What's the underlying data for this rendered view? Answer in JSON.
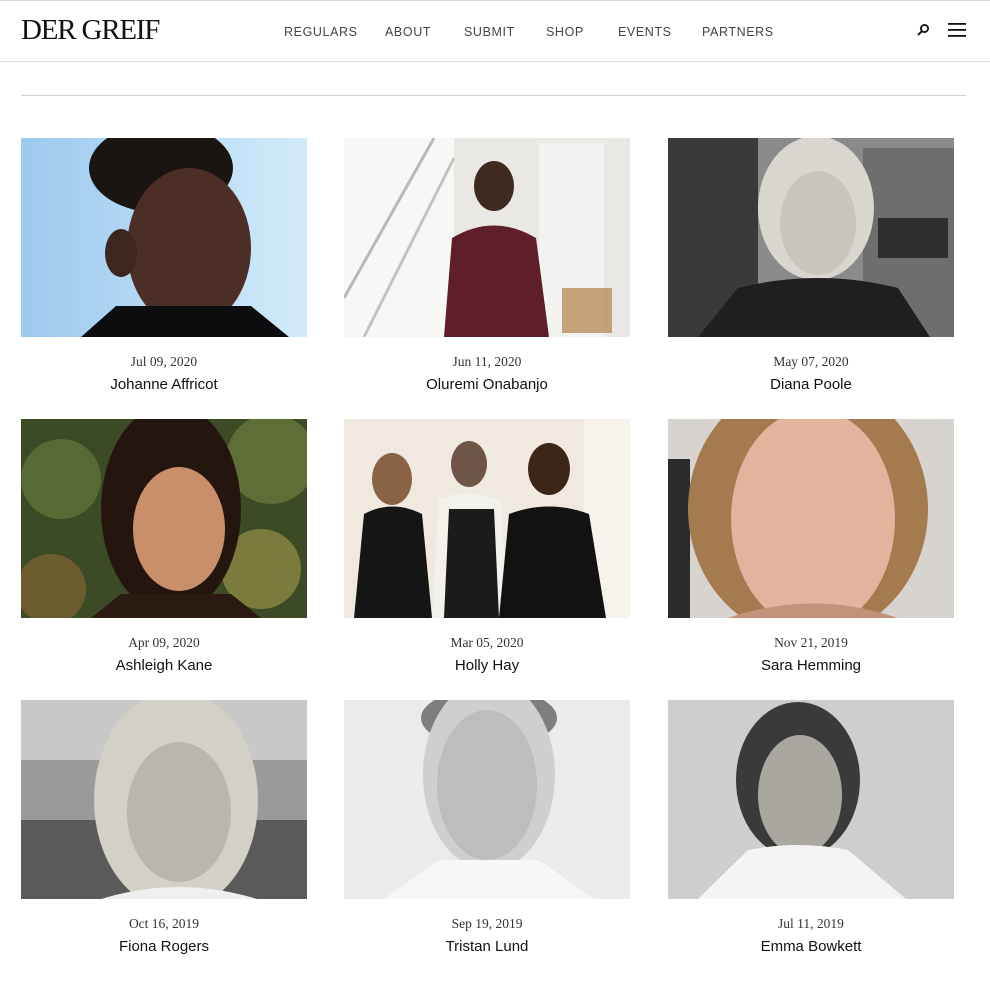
{
  "header": {
    "logo": "DER GREIF",
    "nav": [
      {
        "label": "REGULARS"
      },
      {
        "label": "ABOUT"
      },
      {
        "label": "SUBMIT"
      },
      {
        "label": "SHOP"
      },
      {
        "label": "EVENTS"
      },
      {
        "label": "PARTNERS"
      }
    ],
    "icons": [
      "search-icon",
      "hamburger-menu-icon"
    ]
  },
  "cards": [
    {
      "date": "Jul 09, 2020",
      "name": "Johanne Affricot"
    },
    {
      "date": "Jun 11, 2020",
      "name": "Oluremi Onabanjo"
    },
    {
      "date": "May 07, 2020",
      "name": "Diana Poole"
    },
    {
      "date": "Apr 09, 2020",
      "name": "Ashleigh Kane"
    },
    {
      "date": "Mar 05, 2020",
      "name": "Holly Hay"
    },
    {
      "date": "Nov 21, 2019",
      "name": "Sara Hemming"
    },
    {
      "date": "Oct 16, 2019",
      "name": "Fiona Rogers"
    },
    {
      "date": "Sep 19, 2019",
      "name": "Tristan Lund"
    },
    {
      "date": "Jul 11, 2019",
      "name": "Emma Bowkett"
    }
  ]
}
